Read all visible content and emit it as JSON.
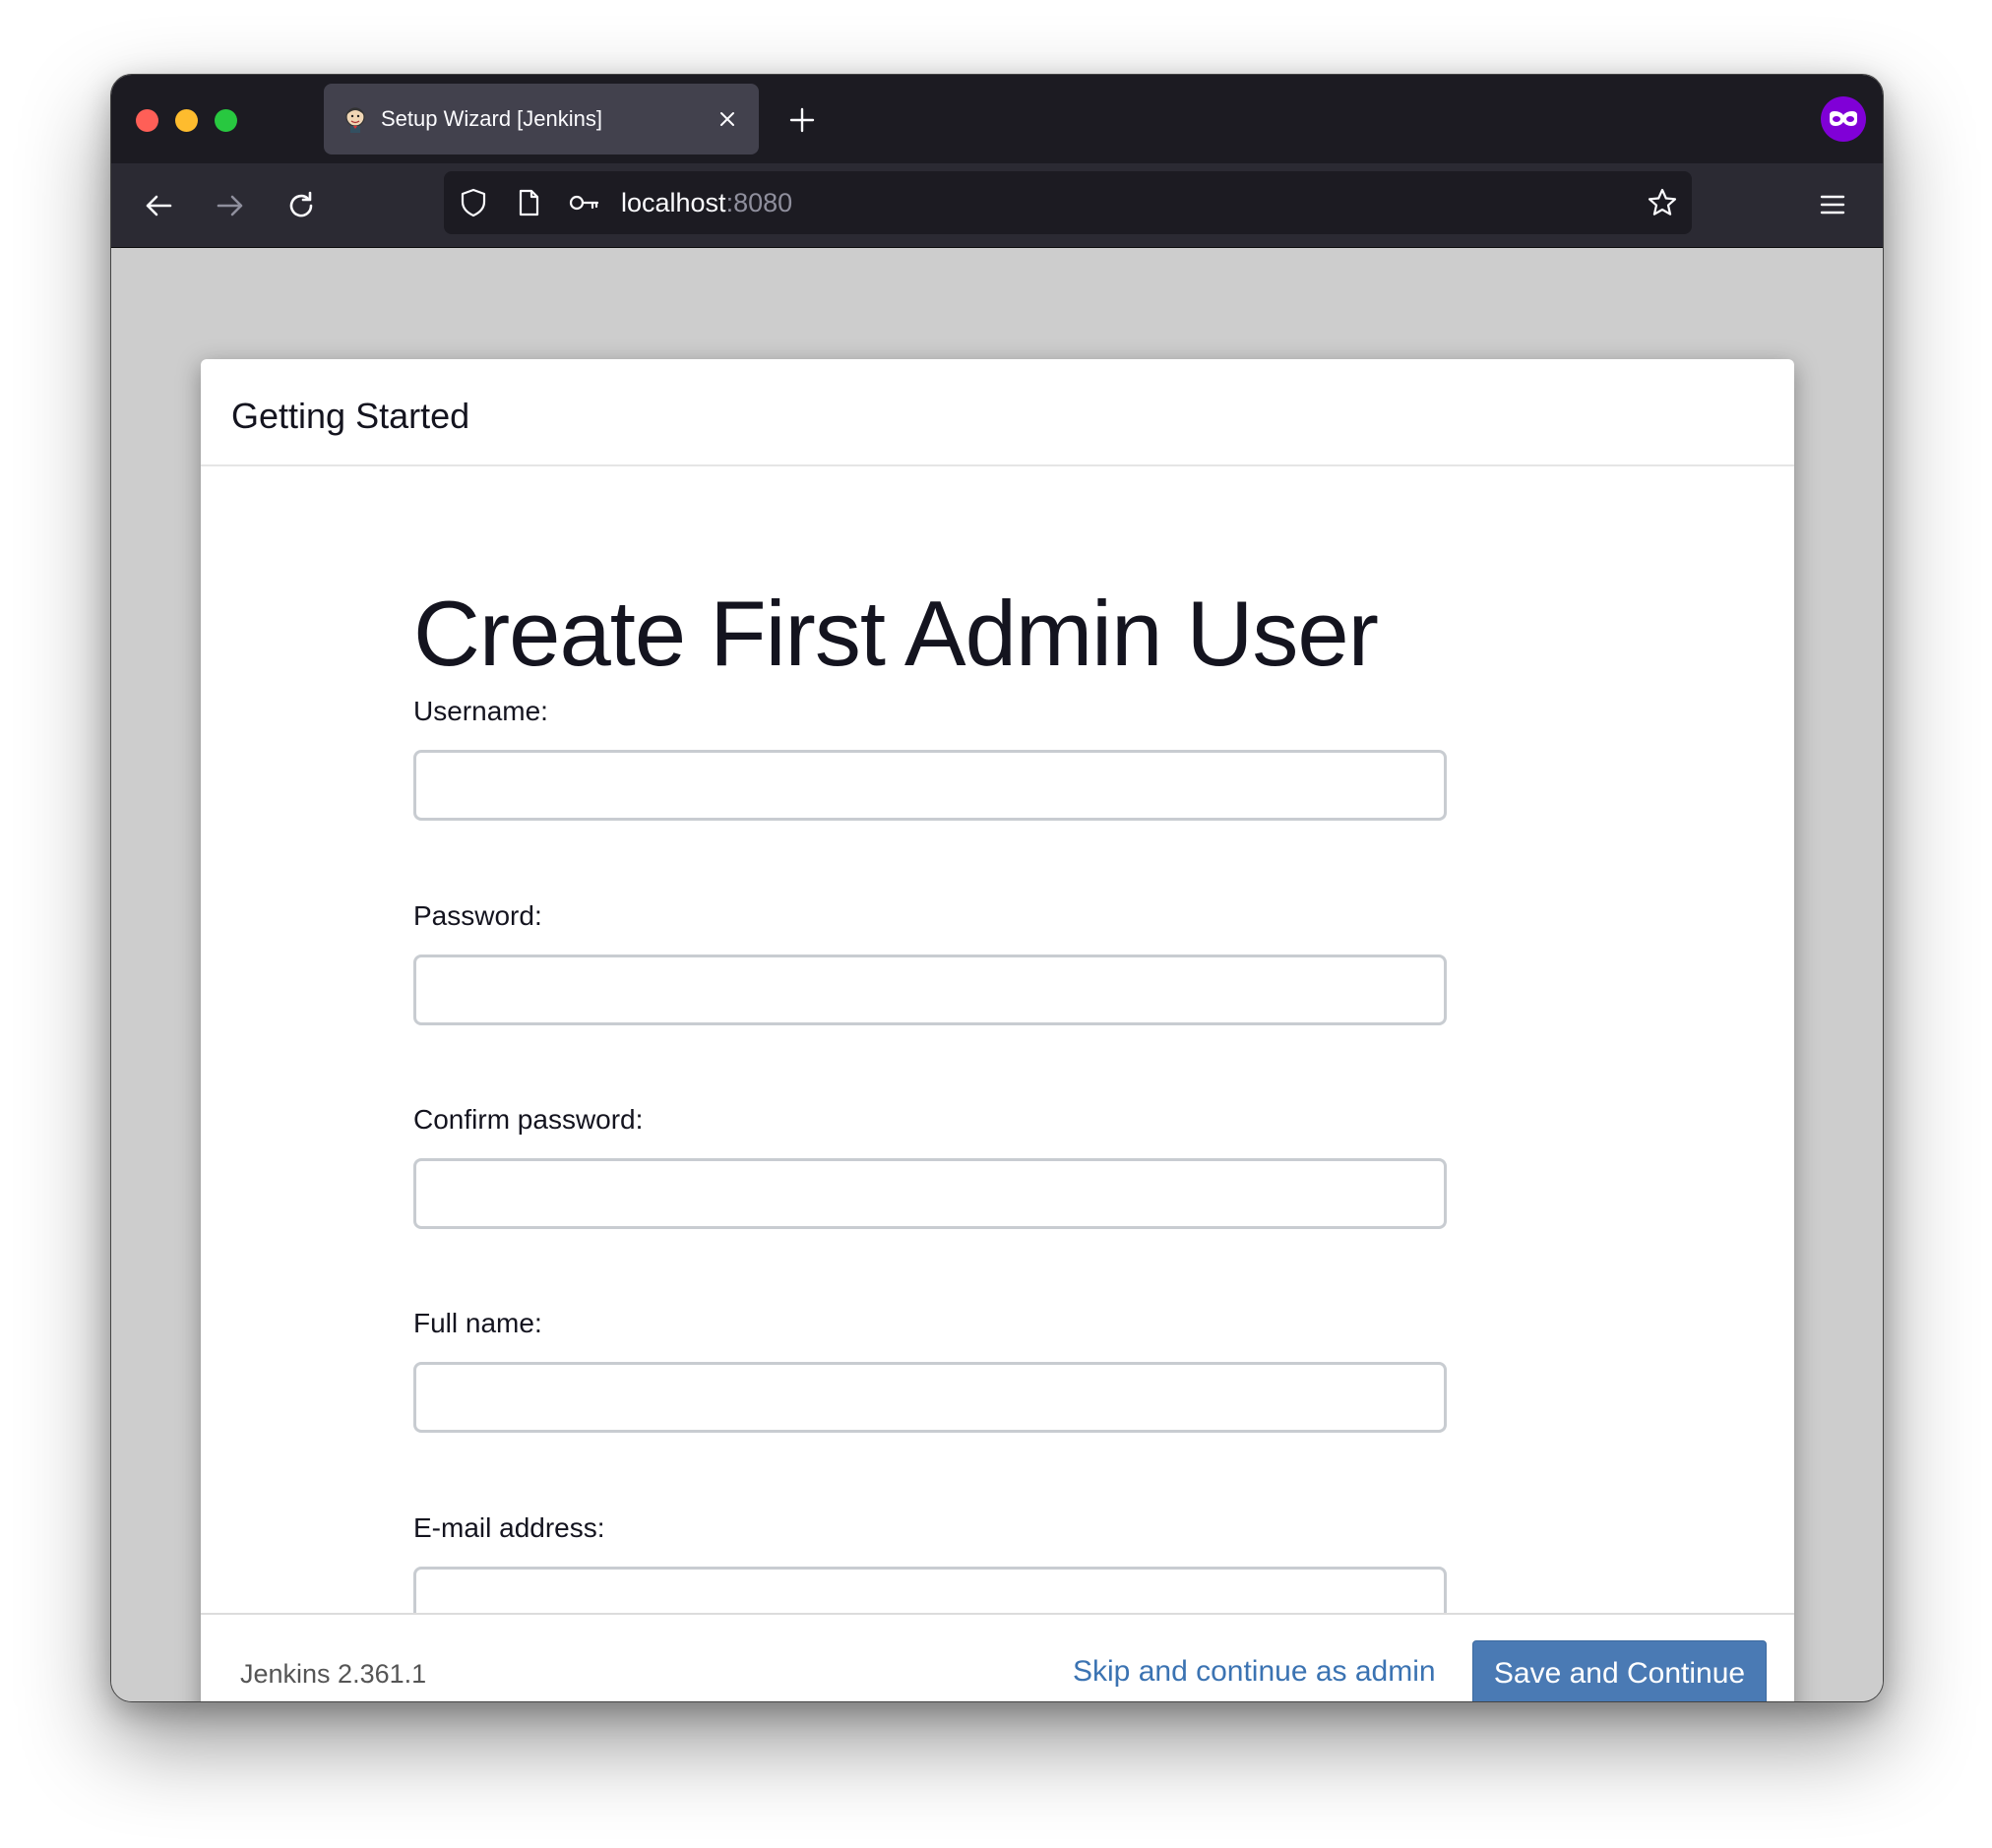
{
  "browser": {
    "tab": {
      "title": "Setup Wizard [Jenkins]",
      "favicon": "jenkins-logo"
    },
    "url": {
      "host": "localhost",
      "port": ":8080"
    },
    "icons": [
      "back-arrow",
      "forward-arrow",
      "reload",
      "shield",
      "page",
      "key",
      "bookmark-star",
      "hamburger-menu",
      "private-browsing-mask",
      "close",
      "plus"
    ],
    "colors": {
      "private_badge": "#8000d7",
      "tab_active": "#42414d",
      "toolbar": "#2b2a33"
    }
  },
  "dialog": {
    "header_title": "Getting Started",
    "form_title": "Create First Admin User",
    "fields": [
      {
        "label": "Username:",
        "value": ""
      },
      {
        "label": "Password:",
        "value": ""
      },
      {
        "label": "Confirm password:",
        "value": ""
      },
      {
        "label": "Full name:",
        "value": ""
      },
      {
        "label": "E-mail address:",
        "value": ""
      }
    ],
    "footer": {
      "version": "Jenkins 2.361.1",
      "skip_label": "Skip and continue as admin",
      "save_label": "Save and Continue"
    },
    "colors": {
      "primary_button": "#4a7ab4",
      "link": "#3b73b2"
    }
  }
}
